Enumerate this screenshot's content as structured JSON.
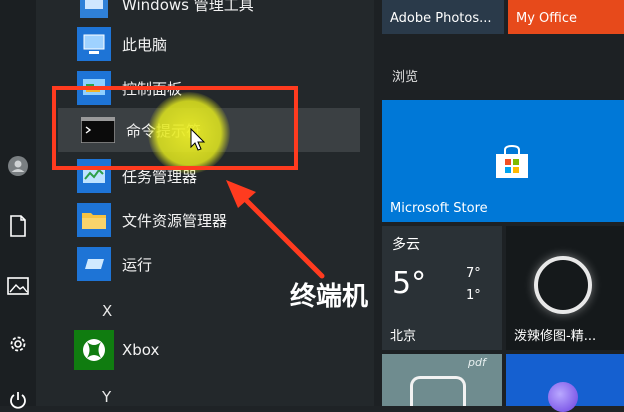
{
  "start_menu": {
    "apps": [
      {
        "label": "Windows 管理工具"
      },
      {
        "label": "此电脑"
      },
      {
        "label": "控制面板"
      },
      {
        "label": "命令提示符"
      },
      {
        "label": "任务管理器"
      },
      {
        "label": "文件资源管理器"
      },
      {
        "label": "运行"
      }
    ],
    "letter_x": "X",
    "xbox_label": "Xbox",
    "letter_y": "Y"
  },
  "tiles": {
    "adobe_label": "Adobe Photos...",
    "office_label": "My Office",
    "section_title": "浏览",
    "store_label": "Microsoft Store",
    "weather": {
      "condition": "多云",
      "temp": "5°",
      "high": "7°",
      "low": "1°",
      "city": "北京"
    },
    "wallpaper_label": "泼辣修图-精...",
    "pdf_label": "pdf"
  },
  "annotation": {
    "text": "终端机"
  },
  "colors": {
    "store_tile": "#0078d7",
    "office_tile": "#e74a1b",
    "highlight_box": "#ff3b1f",
    "xbox_green": "#107c10"
  }
}
